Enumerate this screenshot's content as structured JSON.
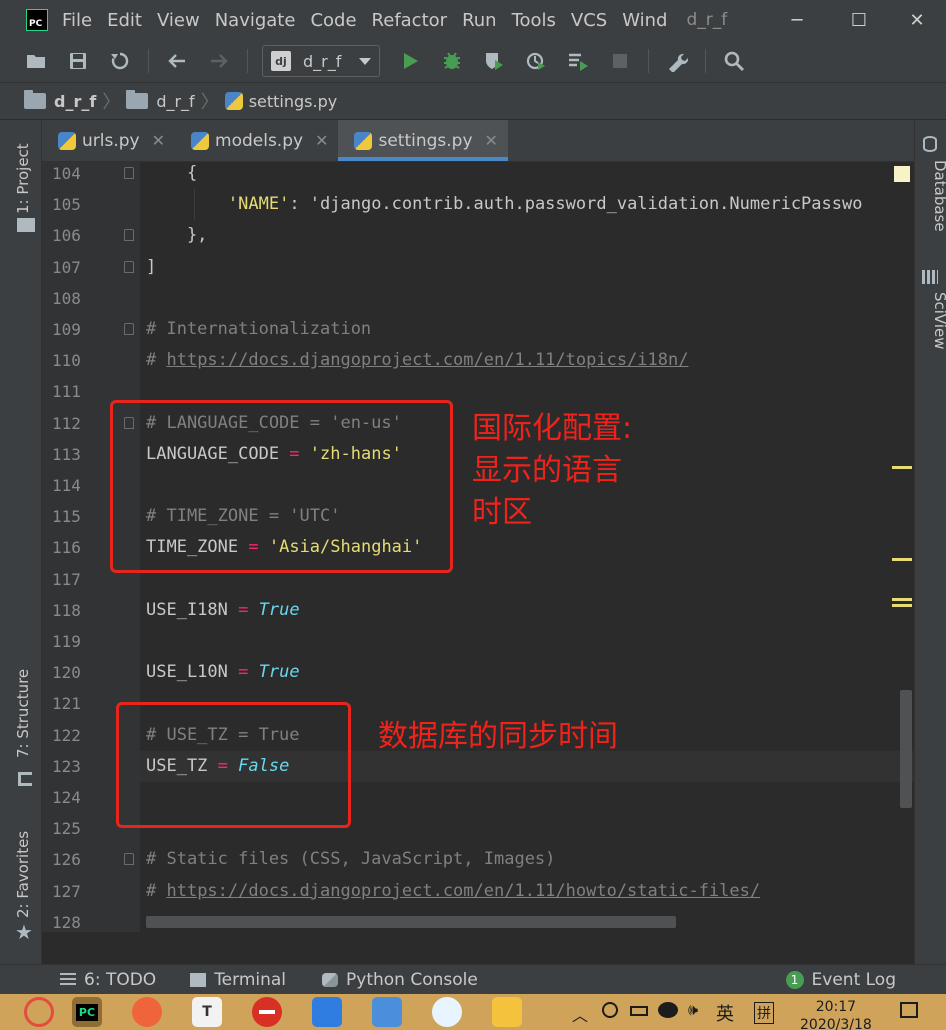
{
  "menu": {
    "items": [
      "File",
      "Edit",
      "View",
      "Navigate",
      "Code",
      "Refactor",
      "Run",
      "Tools",
      "VCS",
      "Wind"
    ],
    "underline": [
      "F",
      "E",
      "V",
      "N",
      "C",
      "R",
      "u",
      "T",
      "",
      "W"
    ],
    "window_title": "d_r_f"
  },
  "window_buttons": {
    "minimize": "─",
    "maximize": "☐",
    "close": "✕"
  },
  "toolbar": {
    "run_config_icon": "dj",
    "run_config_label": "d_r_f"
  },
  "breadcrumb": {
    "root": "d_r_f",
    "folder": "d_r_f",
    "file": "settings.py"
  },
  "left_tools": {
    "project": "1: Project",
    "structure": "7: Structure",
    "favorites": "2: Favorites"
  },
  "right_tools": {
    "database": "Database",
    "sciview": "SciView"
  },
  "tabs": [
    {
      "label": "urls.py",
      "close": "✕"
    },
    {
      "label": "models.py",
      "close": "✕"
    },
    {
      "label": "settings.py",
      "close": "✕"
    }
  ],
  "code_lines": [
    {
      "n": "104",
      "text": "    {"
    },
    {
      "n": "105",
      "text": "        'NAME': 'django.contrib.auth.password_validation.NumericPasswo"
    },
    {
      "n": "106",
      "text": "    },"
    },
    {
      "n": "107",
      "text": "]"
    },
    {
      "n": "108",
      "text": ""
    },
    {
      "n": "109",
      "text": "# Internationalization"
    },
    {
      "n": "110",
      "text": "# https://docs.djangoproject.com/en/1.11/topics/i18n/"
    },
    {
      "n": "111",
      "text": ""
    },
    {
      "n": "112",
      "text": "# LANGUAGE_CODE = 'en-us'"
    },
    {
      "n": "113",
      "text": "LANGUAGE_CODE = 'zh-hans'"
    },
    {
      "n": "114",
      "text": ""
    },
    {
      "n": "115",
      "text": "# TIME_ZONE = 'UTC'"
    },
    {
      "n": "116",
      "text": "TIME_ZONE = 'Asia/Shanghai'"
    },
    {
      "n": "117",
      "text": ""
    },
    {
      "n": "118",
      "text": "USE_I18N = True"
    },
    {
      "n": "119",
      "text": ""
    },
    {
      "n": "120",
      "text": "USE_L10N = True"
    },
    {
      "n": "121",
      "text": ""
    },
    {
      "n": "122",
      "text": "# USE_TZ = True"
    },
    {
      "n": "123",
      "text": "USE_TZ = False"
    },
    {
      "n": "124",
      "text": ""
    },
    {
      "n": "125",
      "text": ""
    },
    {
      "n": "126",
      "text": "# Static files (CSS, JavaScript, Images)"
    },
    {
      "n": "127",
      "text": "# https://docs.djangoproject.com/en/1.11/howto/static-files/"
    },
    {
      "n": "128",
      "text": ""
    }
  ],
  "annotations": {
    "i18n_note": "国际化配置:\n显示的语言\n时区",
    "tz_note": "数据库的同步时间"
  },
  "bottom_bar": {
    "todo": "6: TODO",
    "terminal": "Terminal",
    "python_console": "Python Console",
    "event_log": "Event Log",
    "event_count": "1"
  },
  "taskbar": {
    "ime": "英",
    "ime2": "拼",
    "time": "20:17",
    "date": "2020/3/18"
  },
  "colors": {
    "accent": "#4a88c7",
    "annotation": "#e8251d",
    "string": "#e6db74",
    "keyword": "#66d9ef",
    "operator": "#f92672"
  }
}
